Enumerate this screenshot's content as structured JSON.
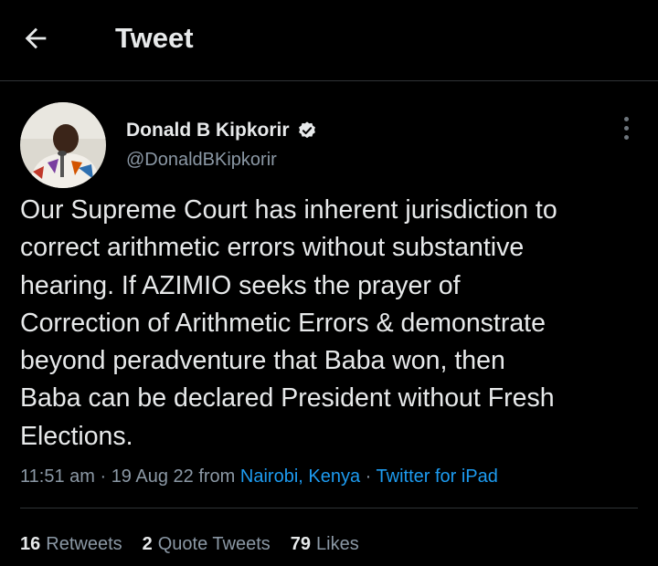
{
  "header": {
    "title": "Tweet"
  },
  "author": {
    "name": "Donald B Kipkorir",
    "handle": "@DonaldBKipkorir",
    "verified": true
  },
  "tweet": {
    "text": "Our Supreme Court has inherent jurisdiction to\ncorrect arithmetic errors without substantive\nhearing. If AZIMIO seeks the prayer of\nCorrection of Arithmetic Errors & demonstrate\nbeyond peradventure that Baba won, then\nBaba can be declared President without Fresh\nElections.",
    "time": "11:51 am",
    "date": "19 Aug 22",
    "from_label": "from",
    "location": "Nairobi, Kenya",
    "source": "Twitter for iPad"
  },
  "stats": {
    "retweets_count": "16",
    "retweets_label": "Retweets",
    "quotes_count": "2",
    "quotes_label": "Quote Tweets",
    "likes_count": "79",
    "likes_label": "Likes"
  },
  "colors": {
    "background": "#000000",
    "text_primary": "#e7e9ea",
    "text_secondary": "#8b98a5",
    "link": "#1d9bf0",
    "divider": "#2f3336"
  },
  "icons": {
    "back": "arrow-left-icon",
    "verified": "verified-badge-icon",
    "more": "more-vertical-icon"
  }
}
